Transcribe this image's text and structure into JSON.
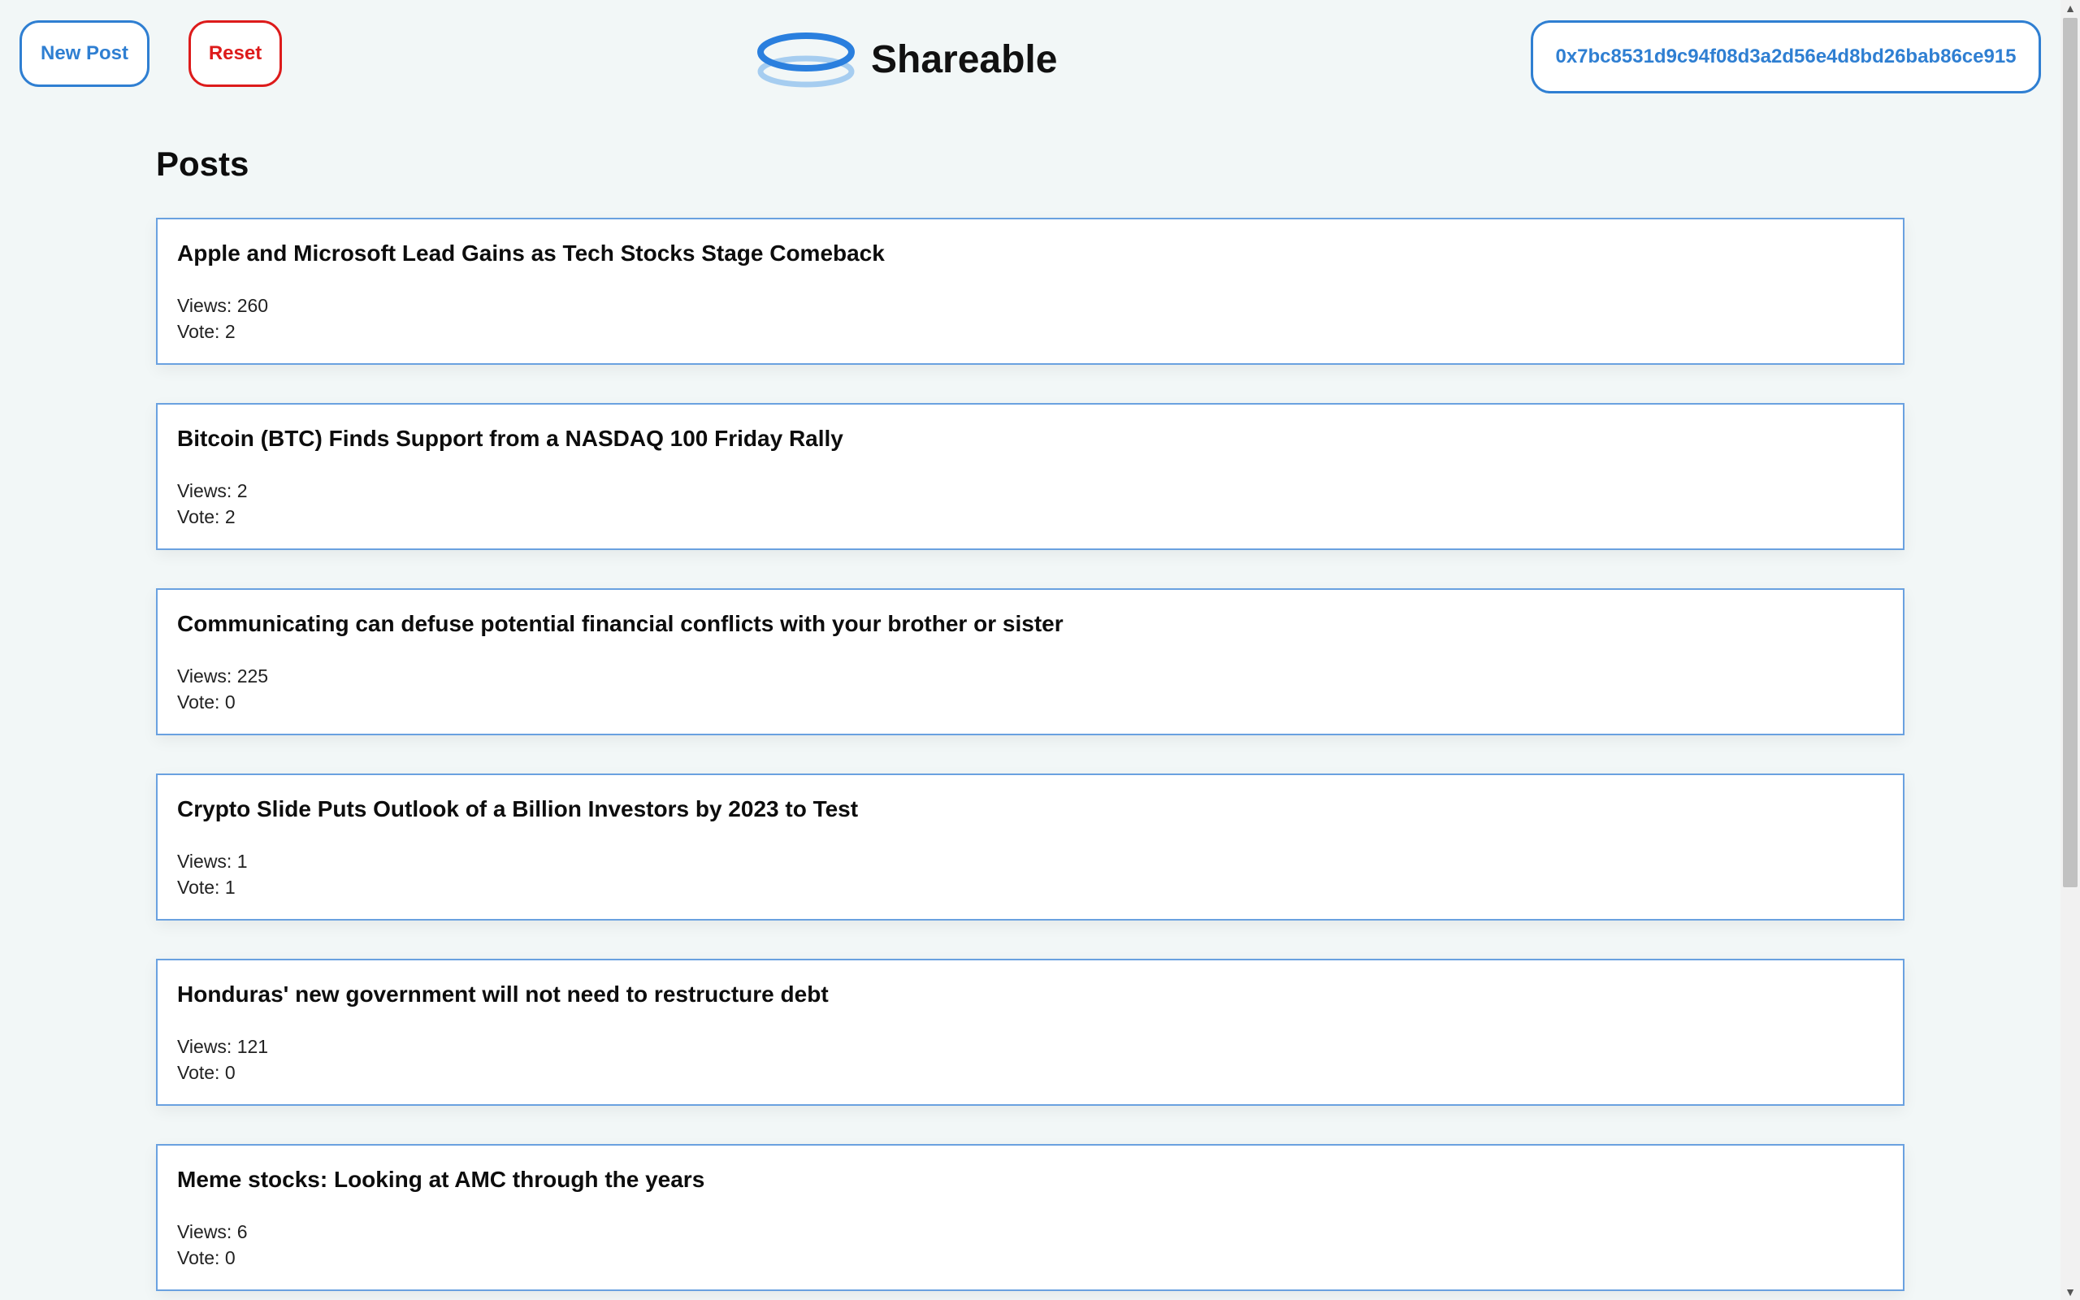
{
  "header": {
    "new_post_label": "New Post",
    "reset_label": "Reset",
    "brand_name": "Shareable",
    "wallet_address": "0x7bc8531d9c94f08d3a2d56e4d8bd26bab86ce915"
  },
  "main": {
    "heading": "Posts",
    "posts": [
      {
        "title": "Apple and Microsoft Lead Gains as Tech Stocks Stage Comeback",
        "views": "Views: 260",
        "vote": "Vote: 2"
      },
      {
        "title": "Bitcoin (BTC) Finds Support from a NASDAQ 100 Friday Rally",
        "views": "Views: 2",
        "vote": "Vote: 2"
      },
      {
        "title": "Communicating can defuse potential financial conflicts with your brother or sister",
        "views": "Views: 225",
        "vote": "Vote: 0"
      },
      {
        "title": "Crypto Slide Puts Outlook of a Billion Investors by 2023 to Test",
        "views": "Views: 1",
        "vote": "Vote: 1"
      },
      {
        "title": "Honduras' new government will not need to restructure debt",
        "views": "Views: 121",
        "vote": "Vote: 0"
      },
      {
        "title": "Meme stocks: Looking at AMC through the years",
        "views": "Views: 6",
        "vote": "Vote: 0"
      }
    ]
  },
  "colors": {
    "accent": "#2f7fd2",
    "danger": "#dd1b1b",
    "background": "#f2f7f7",
    "card_border": "#6aa1e0"
  },
  "icons": {
    "logo": "ring-logo-icon"
  }
}
